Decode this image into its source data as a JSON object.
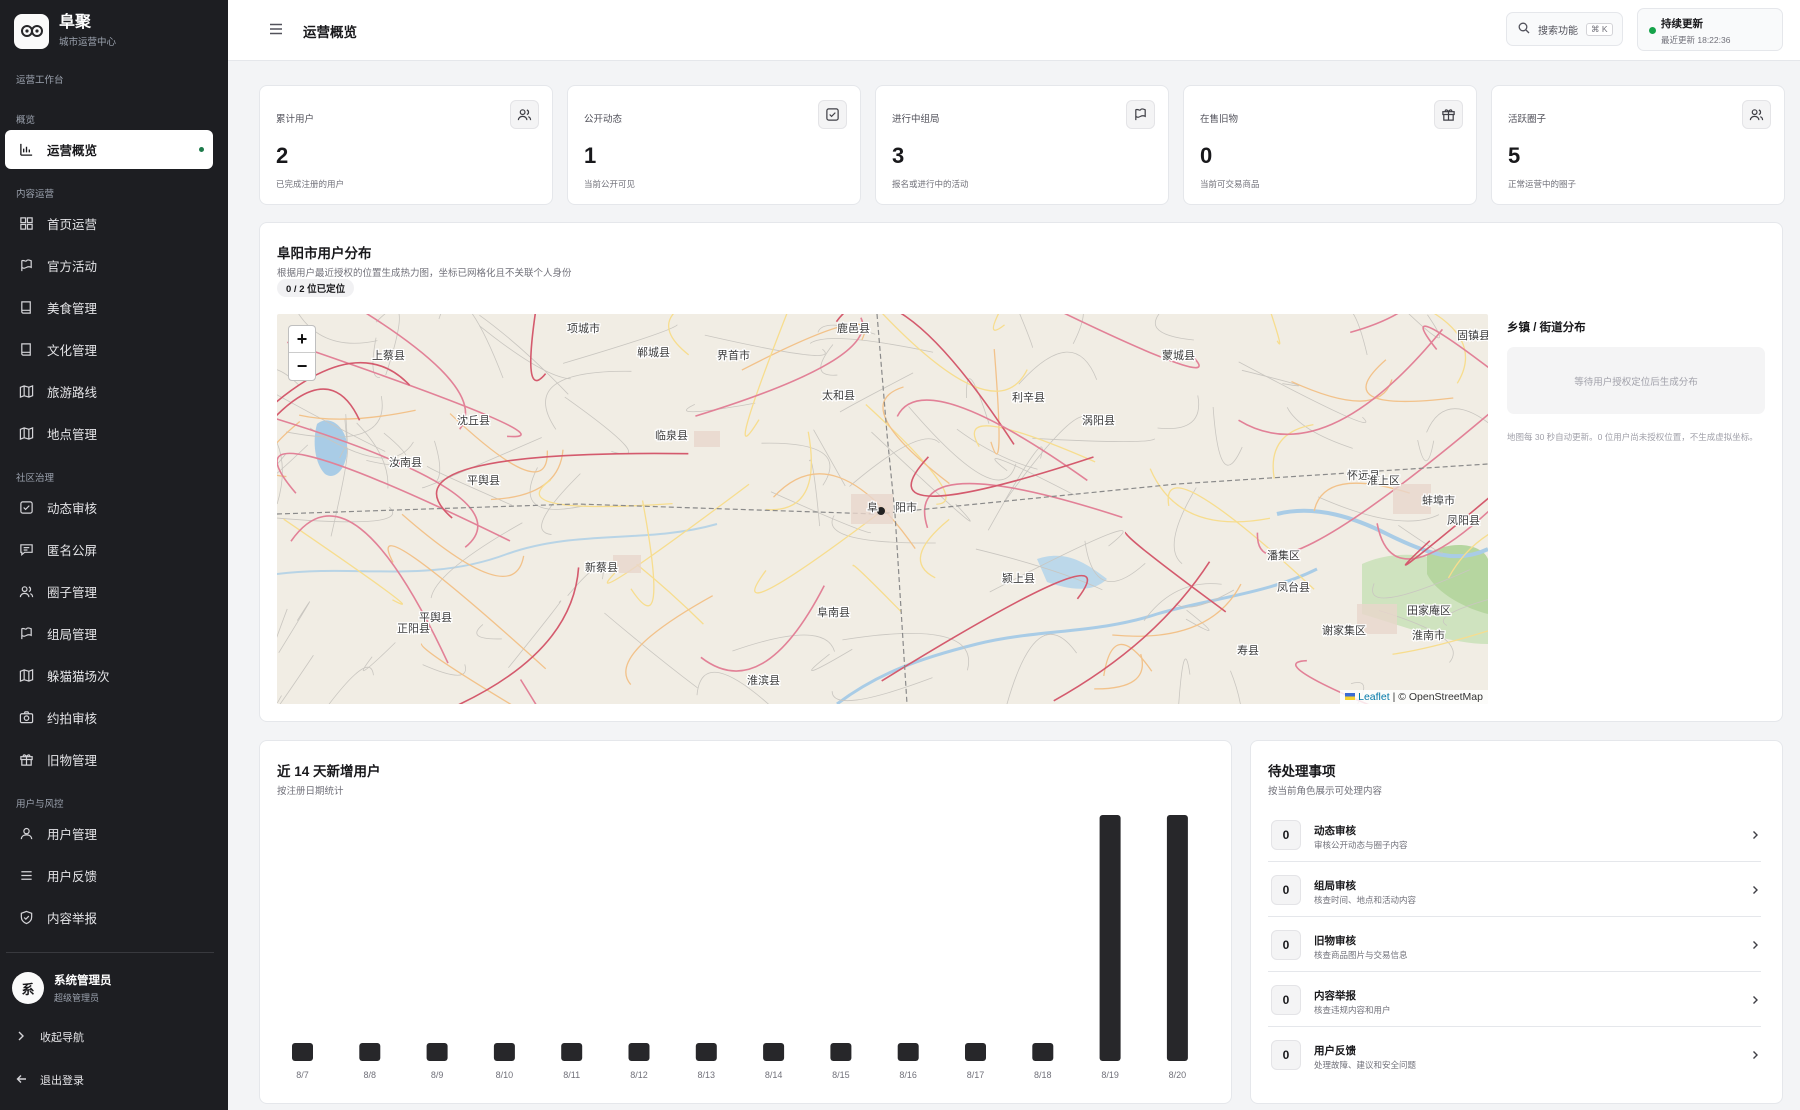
{
  "brand": {
    "name": "阜聚",
    "subtitle": "城市运营中心"
  },
  "sidebar": {
    "workspace_label": "运营工作台",
    "sections": [
      {
        "title": "概览",
        "items": [
          {
            "label": "运营概览",
            "icon": "bar-chart-icon",
            "active": true
          }
        ]
      },
      {
        "title": "内容运营",
        "items": [
          {
            "label": "首页运营",
            "icon": "grid-icon"
          },
          {
            "label": "官方活动",
            "icon": "flag-icon"
          },
          {
            "label": "美食管理",
            "icon": "book-icon"
          },
          {
            "label": "文化管理",
            "icon": "book-icon"
          },
          {
            "label": "旅游路线",
            "icon": "map-icon"
          },
          {
            "label": "地点管理",
            "icon": "map-icon"
          }
        ]
      },
      {
        "title": "社区治理",
        "items": [
          {
            "label": "动态审核",
            "icon": "check-square-icon"
          },
          {
            "label": "匿名公屏",
            "icon": "message-icon"
          },
          {
            "label": "圈子管理",
            "icon": "users-icon"
          },
          {
            "label": "组局管理",
            "icon": "flag-icon"
          },
          {
            "label": "躲猫猫场次",
            "icon": "map-icon"
          },
          {
            "label": "约拍审核",
            "icon": "camera-icon"
          },
          {
            "label": "旧物管理",
            "icon": "gift-icon"
          }
        ]
      },
      {
        "title": "用户与风控",
        "items": [
          {
            "label": "用户管理",
            "icon": "user-icon"
          },
          {
            "label": "用户反馈",
            "icon": "list-icon"
          },
          {
            "label": "内容举报",
            "icon": "shield-icon"
          }
        ]
      }
    ],
    "user": {
      "avatar": "系",
      "name": "系统管理员",
      "role": "超级管理员"
    },
    "collapse_label": "收起导航",
    "logout_label": "退出登录"
  },
  "topbar": {
    "title": "运营概览",
    "search_label": "搜索功能",
    "search_shortcut": "⌘ K",
    "status_title": "持续更新",
    "status_sub": "最近更新 18:22:36"
  },
  "stats": [
    {
      "label": "累计用户",
      "value": "2",
      "sub": "已完成注册的用户",
      "icon": "users-icon"
    },
    {
      "label": "公开动态",
      "value": "1",
      "sub": "当前公开可见",
      "icon": "check-square-icon"
    },
    {
      "label": "进行中组局",
      "value": "3",
      "sub": "报名或进行中的活动",
      "icon": "flag-icon"
    },
    {
      "label": "在售旧物",
      "value": "0",
      "sub": "当前可交易商品",
      "icon": "gift-icon"
    },
    {
      "label": "活跃圈子",
      "value": "5",
      "sub": "正常运营中的圈子",
      "icon": "users-icon"
    }
  ],
  "map_section": {
    "title": "阜阳市用户分布",
    "desc": "根据用户最近授权的位置生成热力图，坐标已网格化且不关联个人身份",
    "badge": "0 / 2 位已定位",
    "zoom_in": "+",
    "zoom_out": "−",
    "attribution_leaflet": "Leaflet",
    "attribution_osm": "| © OpenStreetMap",
    "district_title": "乡镇 / 街道分布",
    "district_empty": "等待用户授权定位后生成分布",
    "district_note": "地图每 30 秒自动更新。0 位用户尚未授权位置，不生成虚拟坐标。",
    "place_labels": [
      "临泉县",
      "界首市",
      "太和县",
      "利辛县",
      "蒙城县",
      "怀远县",
      "蚌埠市",
      "淮南市",
      "颍上县",
      "阜南县",
      "新蔡县",
      "上蔡县",
      "平舆县",
      "平舆县",
      "淮滨县",
      "寿县",
      "凤台县",
      "田家庵区",
      "谢家集区",
      "潘集区",
      "淮上区",
      "固镇县",
      "沈丘县",
      "项城市",
      "郸城县",
      "鹿邑县",
      "涡阳县",
      "正阳县",
      "阜",
      "阳市",
      "汝南县",
      "凤阳县"
    ]
  },
  "chart_section": {
    "title": "近 14 天新增用户",
    "desc": "按注册日期统计"
  },
  "chart_data": {
    "type": "bar",
    "categories": [
      "8/7",
      "8/8",
      "8/9",
      "8/10",
      "8/11",
      "8/12",
      "8/13",
      "8/14",
      "8/15",
      "8/16",
      "8/17",
      "8/18",
      "8/19",
      "8/20"
    ],
    "values": [
      0,
      0,
      0,
      0,
      0,
      0,
      0,
      0,
      0,
      0,
      0,
      0,
      1,
      1
    ],
    "ylim": [
      0,
      1
    ],
    "colors": {
      "bar": "#27272a"
    }
  },
  "todo_section": {
    "title": "待处理事项",
    "desc": "按当前角色展示可处理内容",
    "items": [
      {
        "count": "0",
        "title": "动态审核",
        "desc": "审核公开动态与圈子内容"
      },
      {
        "count": "0",
        "title": "组局审核",
        "desc": "核查时间、地点和活动内容"
      },
      {
        "count": "0",
        "title": "旧物审核",
        "desc": "核查商品图片与交易信息"
      },
      {
        "count": "0",
        "title": "内容举报",
        "desc": "核查违规内容和用户"
      },
      {
        "count": "0",
        "title": "用户反馈",
        "desc": "处理故障、建议和安全问题"
      }
    ]
  }
}
